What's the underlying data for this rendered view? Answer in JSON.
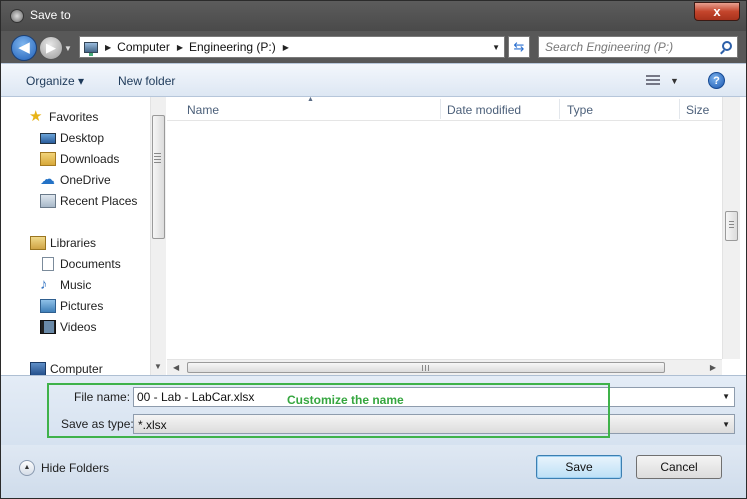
{
  "window": {
    "title": "Save to",
    "close_label": "x"
  },
  "nav": {
    "back_glyph": "◀",
    "forward_glyph": "▶",
    "breadcrumbs": [
      "Computer",
      "Engineering (P:)"
    ],
    "search_placeholder": "Search Engineering (P:)"
  },
  "toolbar": {
    "organize_label": "Organize ▾",
    "new_folder_label": "New folder",
    "help_label": "?"
  },
  "navpane": {
    "favorites": {
      "label": "Favorites",
      "items": [
        "Desktop",
        "Downloads",
        "OneDrive",
        "Recent Places"
      ]
    },
    "libraries": {
      "label": "Libraries",
      "items": [
        "Documents",
        "Music",
        "Pictures",
        "Videos"
      ]
    },
    "computer": {
      "label": "Computer"
    }
  },
  "columns": [
    "Name",
    "Date modified",
    "Type",
    "Size"
  ],
  "form": {
    "file_name_label": "File name:",
    "file_name_value": "00 - Lab - LabCar.xlsx",
    "save_type_label": "Save as type:",
    "save_type_value": "*.xlsx",
    "annotation": "Customize the name",
    "annotation_color": "#35a63f"
  },
  "footer": {
    "hide_folders_label": "Hide Folders",
    "save_label": "Save",
    "cancel_label": "Cancel"
  }
}
